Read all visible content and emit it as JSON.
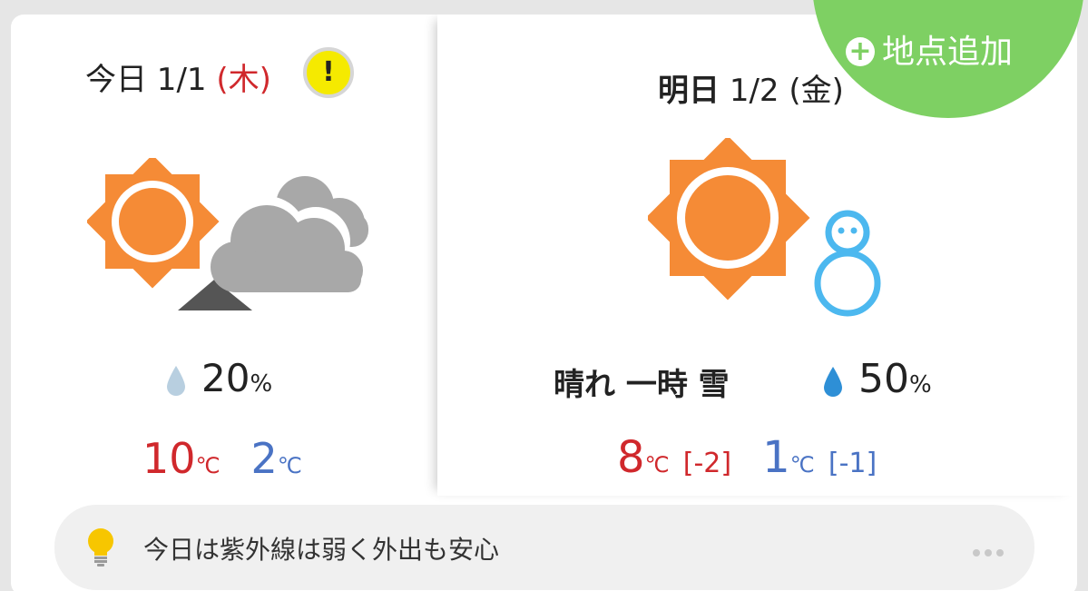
{
  "today": {
    "date": "今日 1/1",
    "weekday": "(木)",
    "alert_symbol": "!",
    "rain_chance": "20",
    "rain_unit": "%",
    "high": "10",
    "low": "2",
    "temp_unit": "℃"
  },
  "tomorrow": {
    "day_label": "明日",
    "date": "1/2 (金)",
    "condition": "晴れ 一時 雪",
    "rain_chance": "50",
    "rain_unit": "%",
    "high": "8",
    "high_diff": "[-2]",
    "low": "1",
    "low_diff": "[-1]",
    "temp_unit": "℃"
  },
  "tip": {
    "text": "今日は紫外線は弱く外出も安心"
  },
  "add_location": {
    "label": "地点追加",
    "plus": "+"
  },
  "icons": {
    "today_weather": "sun-then-cloudy-icon",
    "tomorrow_weather": "sun-with-snowman-icon",
    "alert": "alert-badge-icon",
    "raindrop": "raindrop-icon",
    "tip": "lightbulb-icon",
    "more": "more-dots-icon"
  },
  "colors": {
    "sun": "#f58b36",
    "cloud": "#a8a8a8",
    "snow": "#4cb8ef",
    "high_temp": "#d0282c",
    "low_temp": "#4a73c4",
    "add_button": "#7ed063",
    "alert": "#f5ea00"
  }
}
